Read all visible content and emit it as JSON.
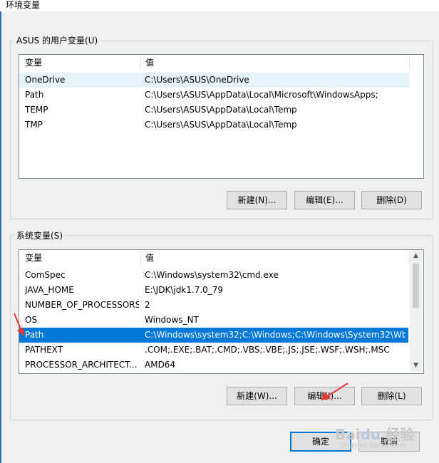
{
  "window": {
    "title": "环境变量"
  },
  "user_vars": {
    "group_title": "ASUS 的用户变量(U)",
    "columns": [
      "变量",
      "值"
    ],
    "rows": [
      {
        "name": "OneDrive",
        "value": "C:\\Users\\ASUS\\OneDrive",
        "state": "light"
      },
      {
        "name": "Path",
        "value": "C:\\Users\\ASUS\\AppData\\Local\\Microsoft\\WindowsApps;",
        "state": "normal"
      },
      {
        "name": "TEMP",
        "value": "C:\\Users\\ASUS\\AppData\\Local\\Temp",
        "state": "normal"
      },
      {
        "name": "TMP",
        "value": "C:\\Users\\ASUS\\AppData\\Local\\Temp",
        "state": "normal"
      }
    ],
    "buttons": {
      "new": "新建(N)...",
      "edit": "编辑(E)...",
      "delete": "删除(D)"
    }
  },
  "system_vars": {
    "group_title": "系统变量(S)",
    "columns": [
      "变量",
      "值"
    ],
    "rows": [
      {
        "name": "ComSpec",
        "value": "C:\\Windows\\system32\\cmd.exe",
        "state": "normal"
      },
      {
        "name": "JAVA_HOME",
        "value": "E:\\JDK\\jdk1.7.0_79",
        "state": "normal"
      },
      {
        "name": "NUMBER_OF_PROCESSORS",
        "value": "2",
        "state": "normal"
      },
      {
        "name": "OS",
        "value": "Windows_NT",
        "state": "normal"
      },
      {
        "name": "Path",
        "value": "C:\\Windows\\system32;C:\\Windows;C:\\Windows\\System32\\Wb...",
        "state": "selected"
      },
      {
        "name": "PATHEXT",
        "value": ".COM;.EXE;.BAT;.CMD;.VBS;.VBE;.JS;.JSE;.WSF;.WSH;.MSC",
        "state": "normal"
      },
      {
        "name": "PROCESSOR_ARCHITECT...",
        "value": "AMD64",
        "state": "normal"
      }
    ],
    "buttons": {
      "new": "新建(W)...",
      "edit": "编辑(I)...",
      "delete": "删除(L)"
    }
  },
  "dialog_buttons": {
    "ok": "确定",
    "cancel": "取消"
  },
  "colors": {
    "selection": "#0078d7",
    "annotation_arrow": "#e53935"
  },
  "watermark": {
    "text": "Baidu 经验",
    "sub": "jingyan.baidu.com"
  }
}
